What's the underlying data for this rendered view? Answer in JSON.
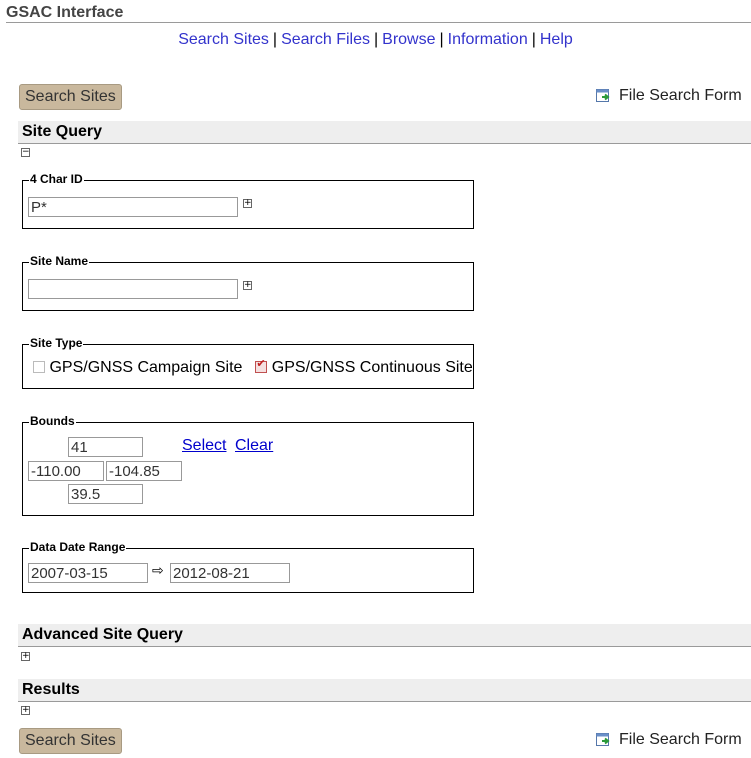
{
  "app": {
    "title": "GSAC Interface"
  },
  "nav": {
    "items": [
      "Search Sites",
      "Search Files",
      "Browse",
      "Information",
      "Help"
    ],
    "separator": "|"
  },
  "toolbar": {
    "search_button": "Search Sites",
    "file_search_link": "File Search Form"
  },
  "sections": {
    "site_query": "Site Query",
    "advanced": "Advanced Site Query",
    "results": "Results"
  },
  "char_id": {
    "legend": "4 Char ID",
    "value": "P*"
  },
  "site_name": {
    "legend": "Site Name",
    "value": ""
  },
  "site_type": {
    "legend": "Site Type",
    "options": [
      {
        "label": "GPS/GNSS Campaign Site",
        "checked": false
      },
      {
        "label": "GPS/GNSS Continuous Site",
        "checked": true
      }
    ]
  },
  "bounds": {
    "legend": "Bounds",
    "north": "41",
    "west": "-110.00",
    "east": "-104.85",
    "south": "39.5",
    "select_label": "Select",
    "clear_label": "Clear"
  },
  "date_range": {
    "legend": "Data Date Range",
    "from": "2007-03-15",
    "to": "2012-08-21",
    "arrow": "⇨"
  },
  "toggles": {
    "collapse": "−",
    "expand": "+"
  },
  "colors": {
    "nav_link": "#3333cc",
    "button_bg": "#c9b89d",
    "link": "#0000cc"
  }
}
